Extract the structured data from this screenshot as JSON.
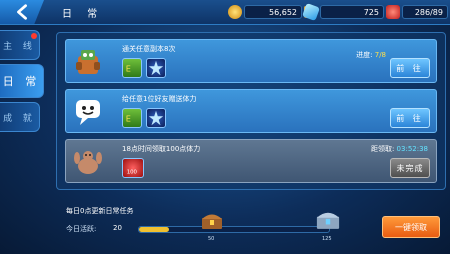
{
  "header": {
    "title": "日 常",
    "gold": "56,652",
    "gems": "725",
    "stamina": "286/89"
  },
  "sidebar": {
    "items": [
      {
        "label": "主 线"
      },
      {
        "label": "日 常"
      },
      {
        "label": "成 就"
      }
    ]
  },
  "tasks": [
    {
      "title": "通关任意副本8次",
      "progress_label": "进度:",
      "progress": "7/8",
      "button": "前 往"
    },
    {
      "title": "给任意1位好友赠送体力",
      "button": "前 往"
    },
    {
      "title": "18点时间领取100点体力",
      "countdown_label": "距领取:",
      "countdown": "03:52:38",
      "button": "未完成",
      "reward_count": "100"
    }
  ],
  "footer": {
    "label": "每日0点更新日常任务",
    "today_label": "今日活跃:",
    "today_value": "20",
    "progress_fraction": 0.16,
    "milestones": [
      "50",
      "125"
    ],
    "onekey_button": "一键领取"
  },
  "colors": {
    "accent": "#2b84d8",
    "highlight": "#ffe04a",
    "orange": "#e85c12"
  }
}
